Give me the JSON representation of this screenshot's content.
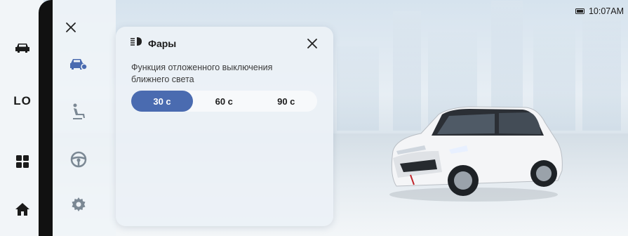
{
  "status": {
    "time": "10:07AM",
    "battery_icon": "battery-icon"
  },
  "left_rail": {
    "items": [
      {
        "name": "car-icon"
      },
      {
        "label": "LO"
      },
      {
        "name": "apps-grid-icon"
      },
      {
        "name": "home-icon"
      }
    ]
  },
  "menu": {
    "close_icon": "close-icon",
    "items": [
      "car-settings-icon",
      "seat-icon",
      "steering-wheel-icon",
      "gear-icon"
    ]
  },
  "dialog": {
    "icon": "headlight-icon",
    "title": "Фары",
    "description": "Функция отложенного выключения ближнего света",
    "options": [
      "30 с",
      "60 с",
      "90 с"
    ],
    "selected": "30 с"
  },
  "colors": {
    "accent": "#4a6bb0",
    "rail": "#111111"
  }
}
